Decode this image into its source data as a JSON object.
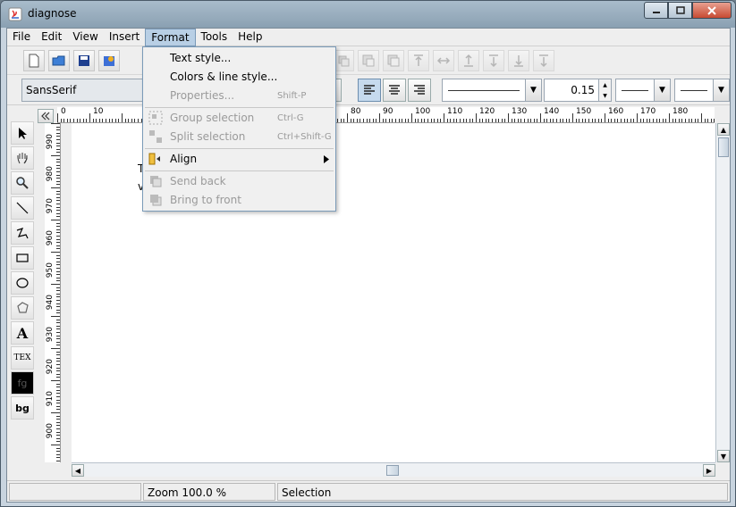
{
  "window": {
    "title": "diagnose",
    "minimize": "0",
    "maximize": "1",
    "close": "r"
  },
  "menubar": [
    "File",
    "Edit",
    "View",
    "Insert",
    "Format",
    "Tools",
    "Help"
  ],
  "format_menu": {
    "items": [
      {
        "label": "Text style...",
        "shortcut": "",
        "enabled": true
      },
      {
        "label": "Colors & line style...",
        "shortcut": "",
        "enabled": true
      },
      {
        "label": "Properties...",
        "shortcut": "Shift-P",
        "enabled": false
      },
      {
        "label": "Group selection",
        "shortcut": "Ctrl-G",
        "enabled": false
      },
      {
        "label": "Split selection",
        "shortcut": "Ctrl+Shift-G",
        "enabled": false
      },
      {
        "label": "Align",
        "shortcut": "",
        "enabled": true
      },
      {
        "label": "Send back",
        "shortcut": "",
        "enabled": false
      },
      {
        "label": "Bring to front",
        "shortcut": "",
        "enabled": false
      }
    ]
  },
  "toolbar": {
    "font": "SansSerif",
    "line_width": "0.15"
  },
  "tools": {
    "text_tool": "A",
    "tex_tool": "TEX",
    "fg": "fg",
    "bg": "bg"
  },
  "canvas": {
    "text1": "T",
    "text2": "v"
  },
  "ruler": {
    "h": [
      "0",
      "10",
      "80",
      "90",
      "100",
      "110",
      "120",
      "130",
      "140",
      "150",
      "160",
      "170",
      "180"
    ],
    "v": [
      "990",
      "980",
      "970",
      "960",
      "950",
      "940",
      "930",
      "920",
      "910",
      "900"
    ]
  },
  "statusbar": {
    "zoom": "Zoom 100.0 %",
    "mode": "Selection"
  },
  "colors": {
    "menu_highlight": "#b8cfe5",
    "fg_swatch": "#000000"
  }
}
